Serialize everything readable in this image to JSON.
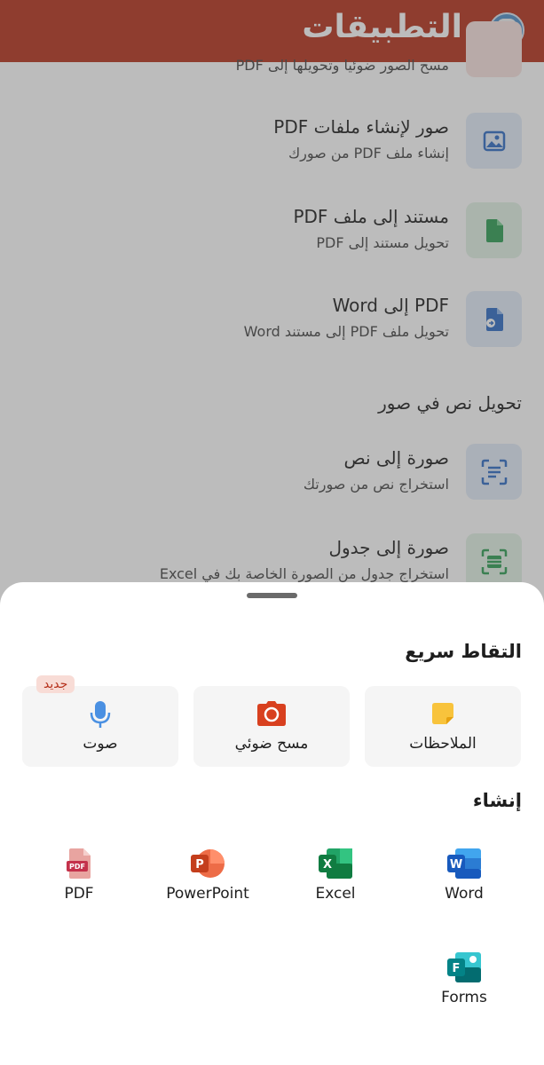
{
  "header": {
    "title": "التطبيقات",
    "color": "#b6321c"
  },
  "tools": [
    {
      "title": "",
      "subtitle": "مسح الصور ضوئيا وتحويلها إلى PDF",
      "icon": "scan-icon"
    },
    {
      "title": "صور لإنشاء ملفات PDF",
      "subtitle": "إنشاء ملف PDF من صورك",
      "icon": "image-icon"
    },
    {
      "title": "مستند إلى ملف PDF",
      "subtitle": "تحويل مستند إلى PDF",
      "icon": "document-icon"
    },
    {
      "title": "PDF إلى Word",
      "subtitle": "تحويل ملف PDF إلى مستند Word",
      "icon": "convert-icon"
    }
  ],
  "section_text_conversion": "تحويل نص في صور",
  "image_tools": [
    {
      "title": "صورة إلى نص",
      "subtitle": "استخراج نص من صورتك",
      "icon": "text-scan-icon"
    },
    {
      "title": "صورة إلى جدول",
      "subtitle": "استخراج جدول من الصورة الخاصة بك في Excel",
      "icon": "table-scan-icon"
    }
  ],
  "sheet": {
    "quick_capture_heading": "التقاط سريع",
    "quick_capture": [
      {
        "label": "الملاحظات",
        "icon": "note-icon",
        "badge": ""
      },
      {
        "label": "مسح ضوئي",
        "icon": "camera-icon",
        "badge": ""
      },
      {
        "label": "صوت",
        "icon": "microphone-icon",
        "badge": "جديد"
      }
    ],
    "create_heading": "إنشاء",
    "create": [
      {
        "label": "Word",
        "icon": "word-icon"
      },
      {
        "label": "Excel",
        "icon": "excel-icon"
      },
      {
        "label": "PowerPoint",
        "icon": "powerpoint-icon"
      },
      {
        "label": "PDF",
        "icon": "pdf-icon"
      },
      {
        "label": "Forms",
        "icon": "forms-icon"
      }
    ]
  }
}
